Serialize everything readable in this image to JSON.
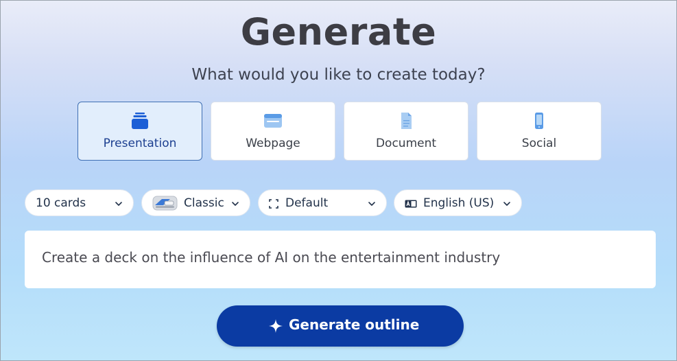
{
  "header": {
    "title": "Generate",
    "subtitle": "What would you like to create today?"
  },
  "types": [
    {
      "label": "Presentation",
      "icon": "cards-stack-icon",
      "selected": true
    },
    {
      "label": "Webpage",
      "icon": "browser-window-icon",
      "selected": false
    },
    {
      "label": "Document",
      "icon": "document-icon",
      "selected": false
    },
    {
      "label": "Social",
      "icon": "phone-icon",
      "selected": false
    }
  ],
  "options": {
    "cards": "10 cards",
    "theme": "Classic",
    "layout": "Default",
    "language": "English (US)"
  },
  "prompt": {
    "value": "Create a deck on the influence of AI on the entertainment industry"
  },
  "actions": {
    "generate_label": "Generate outline"
  },
  "colors": {
    "accent": "#0b3ba3",
    "selected_card_bg": "#e2eefc",
    "selected_card_border": "#3f6fb3",
    "icon_blue": "#1c5fd6"
  }
}
